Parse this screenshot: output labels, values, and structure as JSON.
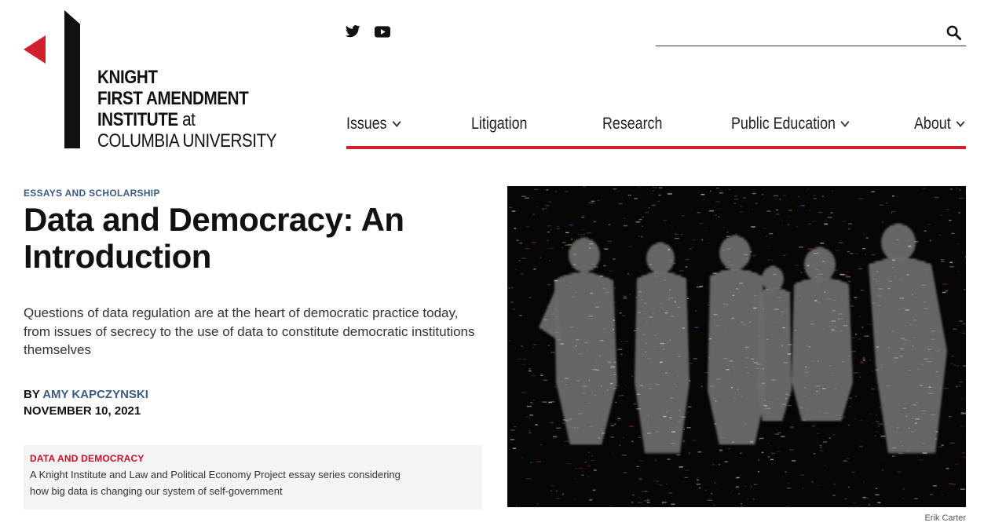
{
  "logo": {
    "line1": "KNIGHT",
    "line2": "FIRST AMENDMENT",
    "line3_bold": "INSTITUTE",
    "line3_rest": " at",
    "line4": "COLUMBIA UNIVERSITY"
  },
  "social": {
    "icons": [
      "twitter-icon",
      "youtube-icon"
    ]
  },
  "search": {
    "value": "",
    "placeholder": ""
  },
  "nav": {
    "items": [
      {
        "label": "Issues",
        "has_dropdown": true
      },
      {
        "label": "Litigation",
        "has_dropdown": false
      },
      {
        "label": "Research",
        "has_dropdown": false
      },
      {
        "label": "Public Education",
        "has_dropdown": true
      },
      {
        "label": "About",
        "has_dropdown": true
      }
    ]
  },
  "article": {
    "eyebrow": "ESSAYS AND SCHOLARSHIP",
    "title": "Data and Democracy: An Introduction",
    "dek": "Questions of data regulation are at the heart of democratic practice today, from issues of secrecy to the use of data to constitute democratic institutions themselves",
    "byline_prefix": "BY ",
    "author": "AMY KAPCZYNSKI",
    "date": "NOVEMBER 10, 2021"
  },
  "series": {
    "title": "DATA AND DEMOCRACY",
    "description": "A Knight Institute and Law and Political Economy Project essay series considering how big data is changing our system of self-government"
  },
  "hero": {
    "credit": "Erik Carter"
  },
  "colors": {
    "accent_red": "#d11f2e",
    "link_blue": "#3d5a80",
    "series_red": "#c8102e"
  }
}
